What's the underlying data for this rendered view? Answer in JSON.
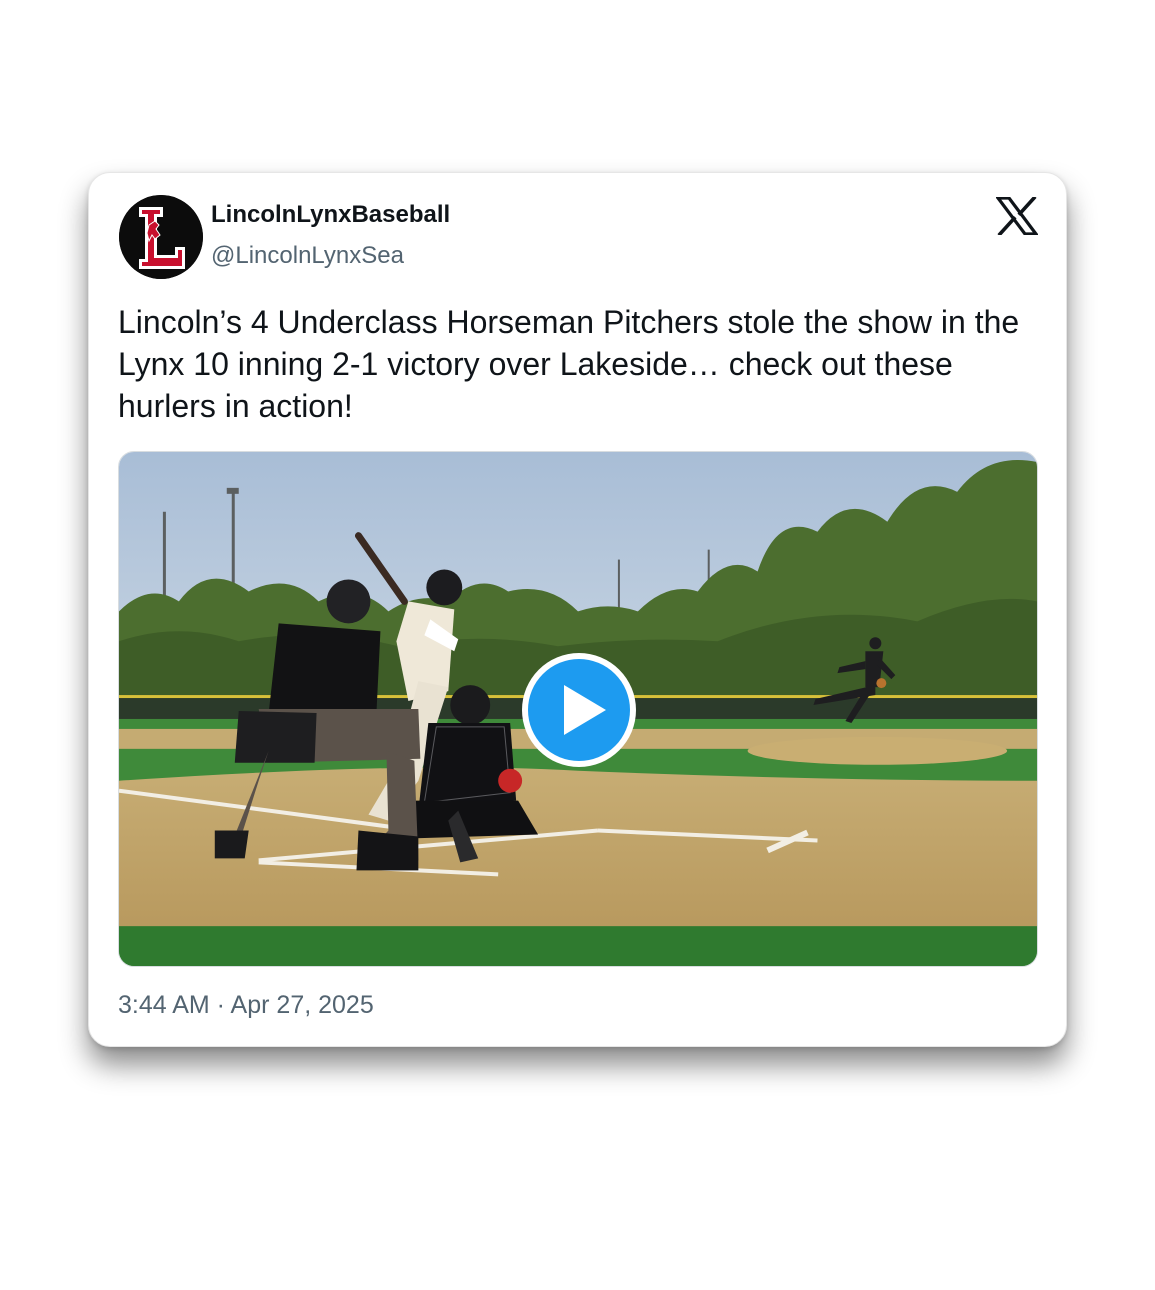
{
  "tweet": {
    "display_name": "LincolnLynxBaseball",
    "handle": "@LincolnLynxSea",
    "avatar_icon": "lincoln-l-logo",
    "platform_icon": "x-logo",
    "text": "Lincoln’s 4 Underclass Horseman Pitchers stole the show in the Lynx 10 inning 2-1 victory over Lakeside… check out these hurlers in action!",
    "timestamp": "3:44 AM · Apr 27, 2025"
  },
  "media": {
    "type": "video",
    "play_icon": "play-icon",
    "play_button_color": "#1d9bf0"
  },
  "colors": {
    "text_primary": "#0f1419",
    "text_secondary": "#536471",
    "brand_red": "#c8102e"
  }
}
